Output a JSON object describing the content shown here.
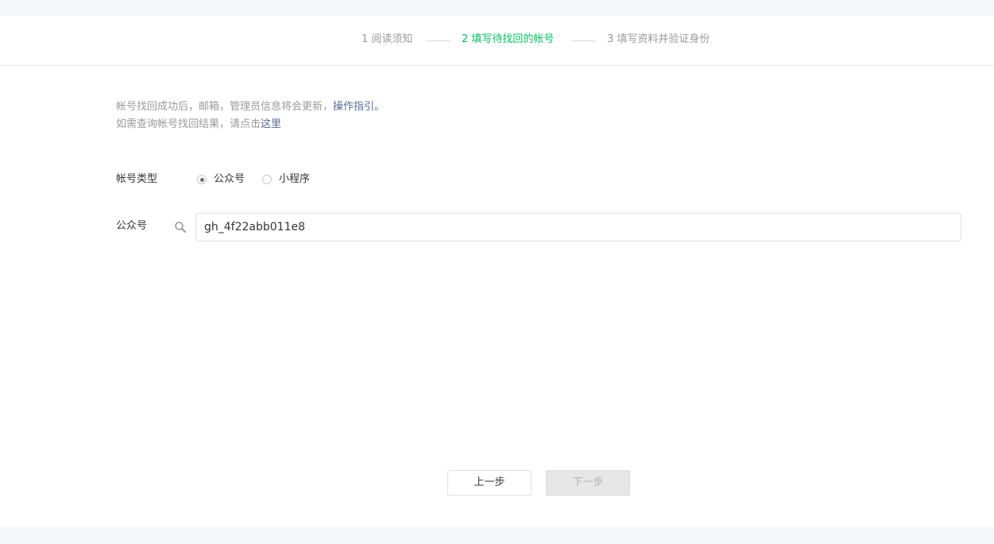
{
  "steps": [
    {
      "label": "1 阅读须知",
      "active": false
    },
    {
      "label": "2 填写待找回的帐号",
      "active": true
    },
    {
      "label": "3 填写资料并验证身份",
      "active": false
    }
  ],
  "notice": {
    "line1_text": "帐号找回成功后，邮箱，管理员信息将会更新，",
    "line1_link": "操作指引。",
    "line2_text": "如需查询帐号找回结果，请点击",
    "line2_link": "这里"
  },
  "account_type": {
    "label": "帐号类型",
    "options": [
      {
        "label": "公众号",
        "checked": true
      },
      {
        "label": "小程序",
        "checked": false
      }
    ]
  },
  "account_field": {
    "label": "公众号",
    "icon": "search-icon",
    "value": "gh_4f22abb011e8"
  },
  "buttons": {
    "prev_label": "上一步",
    "next_label": "下一步"
  },
  "colors": {
    "accent": "#07c160",
    "link": "#576b95"
  }
}
